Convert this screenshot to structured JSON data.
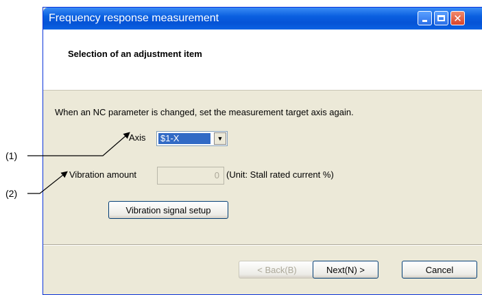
{
  "window": {
    "title": "Frequency response measurement",
    "controls": {
      "minimize_icon": "minimize-icon",
      "maximize_icon": "maximize-icon",
      "close_icon": "close-icon",
      "close_glyph": "✕"
    }
  },
  "header": {
    "title": "Selection of an adjustment item"
  },
  "instruction": "When an NC parameter is changed, set the measurement target axis again.",
  "axis": {
    "label": "Axis",
    "selected": "$1-X",
    "dropdown_glyph": "▼"
  },
  "vibration": {
    "label": "Vibration amount",
    "value": "0",
    "unit": "(Unit: Stall rated current %)"
  },
  "buttons": {
    "signal_setup": "Vibration signal setup",
    "back": "< Back(B)",
    "next": "Next(N) >",
    "cancel": "Cancel"
  },
  "callouts": {
    "one": "(1)",
    "two": "(2)"
  },
  "colors": {
    "title_bar": "#0553d6",
    "dialog_bg": "#ece9d8",
    "selection": "#316ac5"
  }
}
